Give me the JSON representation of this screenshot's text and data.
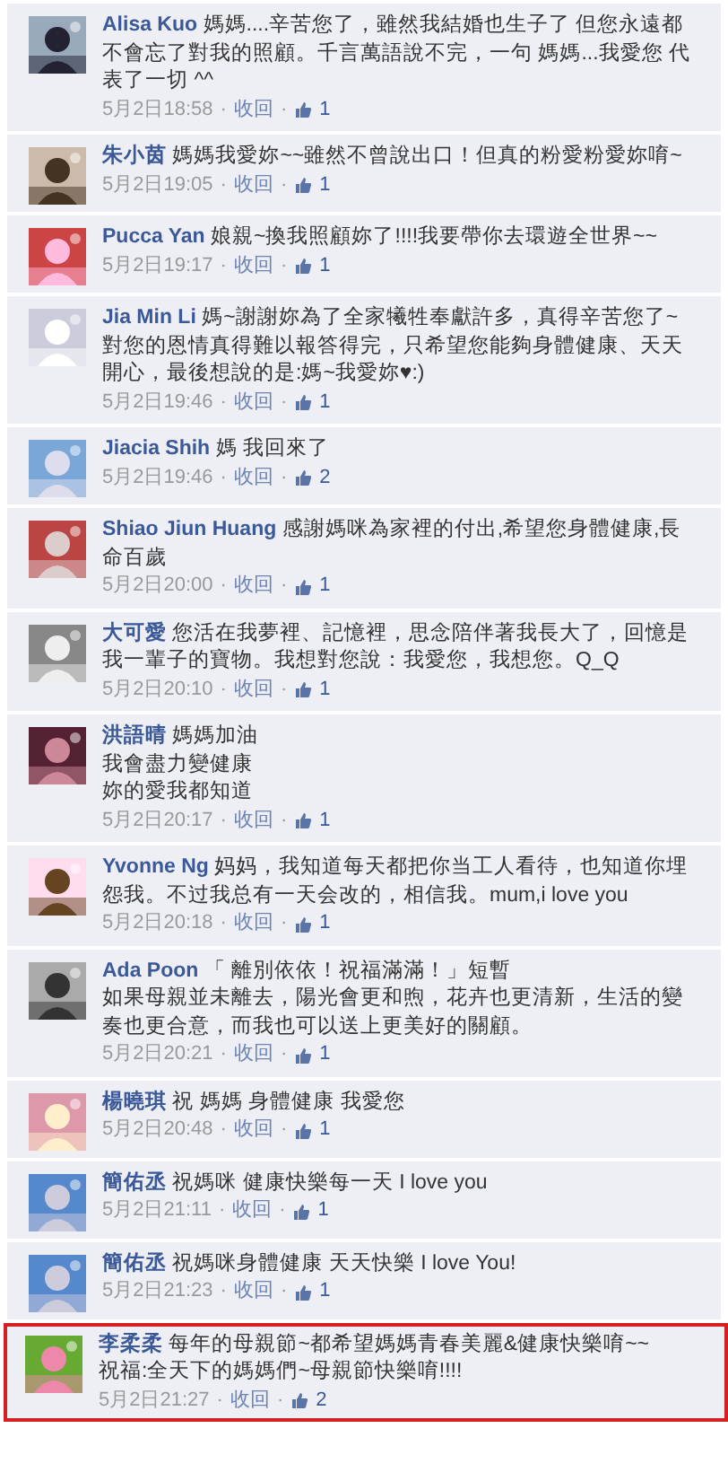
{
  "separator": "·",
  "comments": [
    {
      "author": "Alisa Kuo",
      "text": "媽媽....辛苦您了，雖然我結婚也生子了 但您永遠都不會忘了對我的照顧。千言萬語說不完，一句 媽媽...我愛您 代表了一切 ^^",
      "time": "5月2日18:58",
      "action": "收回",
      "likes": "1",
      "highlighted": false
    },
    {
      "author": "朱小茵",
      "text": "媽媽我愛妳~~雖然不曾說出口！但真的粉愛粉愛妳唷~",
      "time": "5月2日19:05",
      "action": "收回",
      "likes": "1",
      "highlighted": false
    },
    {
      "author": "Pucca Yan",
      "text": "娘親~換我照顧妳了!!!!我要帶你去環遊全世界~~",
      "time": "5月2日19:17",
      "action": "收回",
      "likes": "1",
      "highlighted": false
    },
    {
      "author": "Jia Min Li",
      "text": "媽~謝謝妳為了全家犧牲奉獻許多，真得辛苦您了~對您的恩情真得難以報答得完，只希望您能夠身體健康、天天開心，最後想說的是:媽~我愛妳♥:)",
      "time": "5月2日19:46",
      "action": "收回",
      "likes": "1",
      "highlighted": false
    },
    {
      "author": "Jiacia Shih",
      "text": "媽 我回來了",
      "time": "5月2日19:46",
      "action": "收回",
      "likes": "2",
      "highlighted": false
    },
    {
      "author": "Shiao Jiun Huang",
      "text": "感謝媽咪為家裡的付出,希望您身體健康,長命百歲",
      "time": "5月2日20:00",
      "action": "收回",
      "likes": "1",
      "highlighted": false
    },
    {
      "author": "大可愛",
      "text": "您活在我夢裡、記憶裡，思念陪伴著我長大了，回憶是我一輩子的寶物。我想對您說：我愛您，我想您。Q_Q",
      "time": "5月2日20:10",
      "action": "收回",
      "likes": "1",
      "highlighted": false
    },
    {
      "author": "洪語晴",
      "text": [
        "媽媽加油",
        "我會盡力變健康",
        "妳的愛我都知道"
      ],
      "time": "5月2日20:17",
      "action": "收回",
      "likes": "1",
      "highlighted": false
    },
    {
      "author": "Yvonne Ng",
      "text": "妈妈，我知道每天都把你当工人看待，也知道你埋怨我。不过我总有一天会改的，相信我。mum,i love you",
      "time": "5月2日20:18",
      "action": "收回",
      "likes": "1",
      "highlighted": false
    },
    {
      "author": "Ada Poon",
      "text": [
        "「 離別依依！祝福滿滿！」短暫",
        "如果母親並未離去，陽光會更和煦，花卉也更清新，生活的變奏也更合意，而我也可以送上更美好的關顧。"
      ],
      "time": "5月2日20:21",
      "action": "收回",
      "likes": "1",
      "highlighted": false
    },
    {
      "author": "楊曉琪",
      "text": "祝 媽媽 身體健康 我愛您",
      "time": "5月2日20:48",
      "action": "收回",
      "likes": "1",
      "highlighted": false
    },
    {
      "author": "簡佑丞",
      "text": "祝媽咪 健康快樂每一天 I love you",
      "time": "5月2日21:11",
      "action": "收回",
      "likes": "1",
      "highlighted": false
    },
    {
      "author": "簡佑丞",
      "text": "祝媽咪身體健康 天天快樂 I love You!",
      "time": "5月2日21:23",
      "action": "收回",
      "likes": "1",
      "highlighted": false
    },
    {
      "author": "李柔柔",
      "text": [
        "每年的母親節~都希望媽媽青春美麗&健康快樂唷~~",
        "祝福:全天下的媽媽們~母親節快樂唷!!!!"
      ],
      "time": "5月2日21:27",
      "action": "收回",
      "likes": "2",
      "highlighted": true
    }
  ]
}
